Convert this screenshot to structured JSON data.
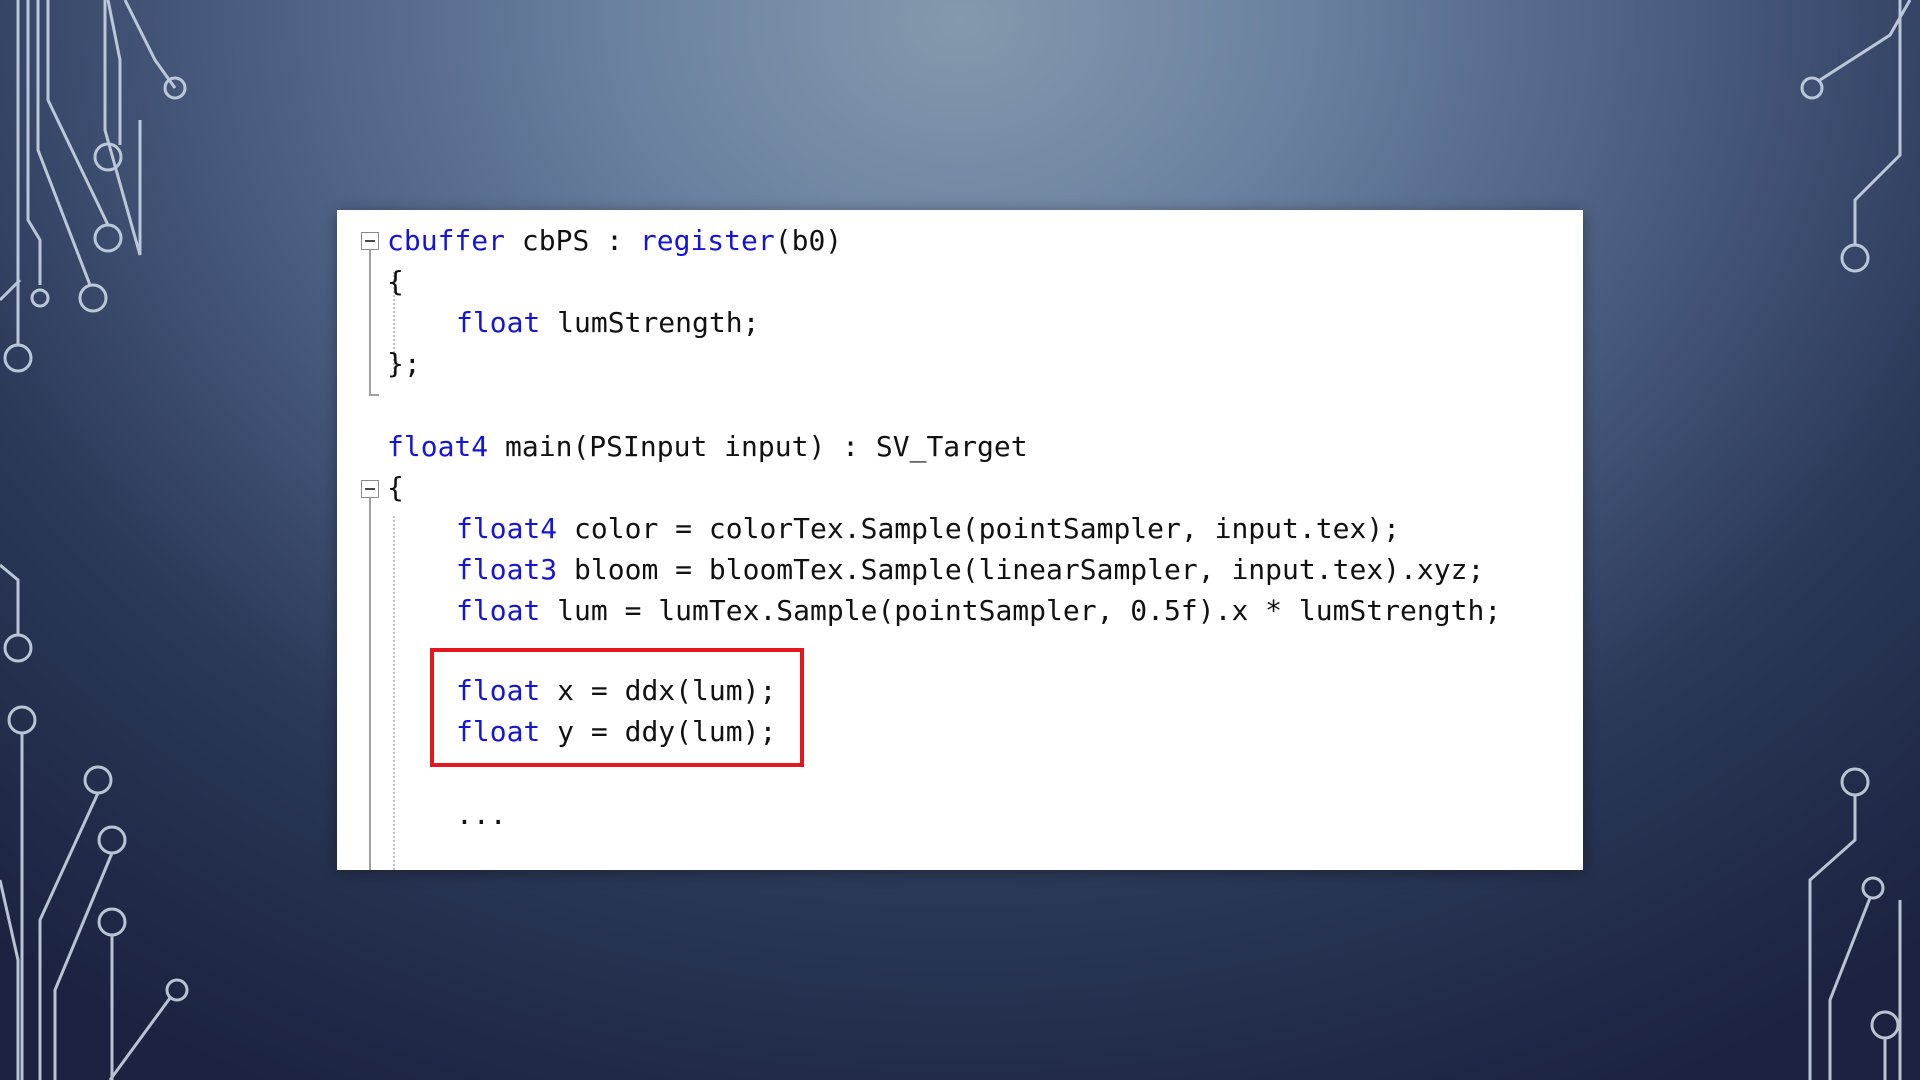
{
  "code": {
    "lines": [
      {
        "kw": "cbuffer",
        "rest": " cbPS : "
      },
      {
        "kw": "",
        "rest": "{"
      },
      {
        "kw": "float",
        "rest": " lumStrength;"
      },
      {
        "kw": "",
        "rest": "};"
      },
      {
        "kw": "float4",
        "rest": " main(PSInput input) : SV_Target"
      },
      {
        "kw": "",
        "rest": "{"
      },
      {
        "kw": "float4",
        "rest": " color = colorTex.Sample(pointSampler, input.tex);"
      },
      {
        "kw": "float3",
        "rest": " bloom = bloomTex.Sample(linearSampler, input.tex).xyz;"
      },
      {
        "kw": "float",
        "rest": " lum = lumTex.Sample(pointSampler, 0.5f).x * lumStrength;"
      },
      {
        "kw": "float",
        "rest": " x = ddx(lum);"
      },
      {
        "kw": "float",
        "rest": " y = ddy(lum);"
      },
      {
        "kw": "",
        "rest": "..."
      }
    ],
    "register_keyword": "register",
    "register_arg": "(b0)"
  },
  "colors": {
    "keyword": "#1515d8",
    "text": "#111111",
    "highlight_border": "#e3171d",
    "panel_background": "#ffffff"
  },
  "icons": [
    "fold-collapse-icon"
  ]
}
